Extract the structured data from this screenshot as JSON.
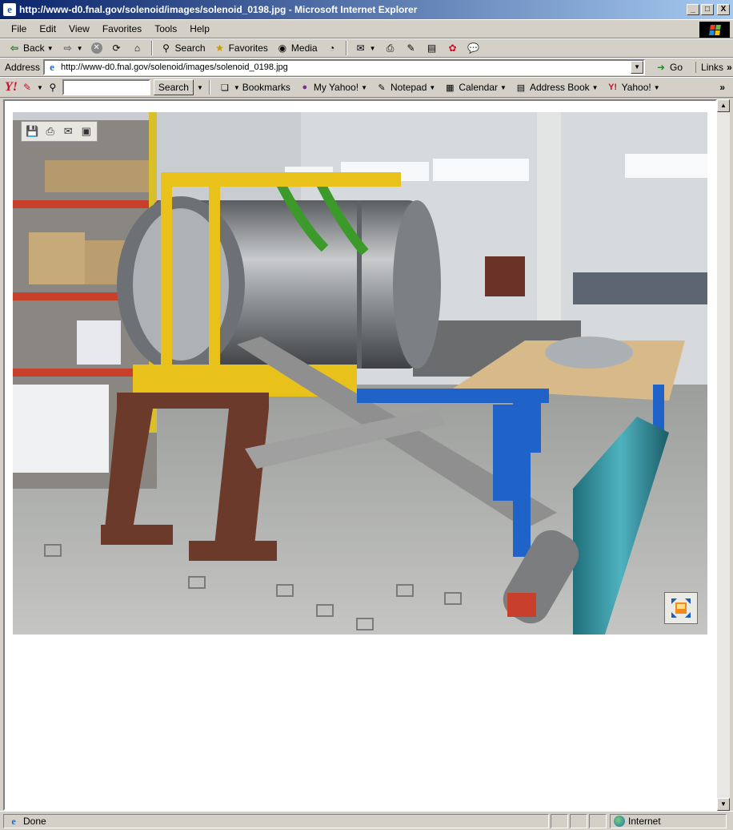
{
  "window": {
    "title": "http://www-d0.fnal.gov/solenoid/images/solenoid_0198.jpg - Microsoft Internet Explorer",
    "controls": {
      "minimize": "_",
      "maximize": "□",
      "close": "X"
    }
  },
  "menu": [
    {
      "label": "File"
    },
    {
      "label": "Edit"
    },
    {
      "label": "View"
    },
    {
      "label": "Favorites"
    },
    {
      "label": "Tools"
    },
    {
      "label": "Help"
    }
  ],
  "toolbar": {
    "back_label": "Back",
    "search_label": "Search",
    "favorites_label": "Favorites",
    "media_label": "Media"
  },
  "address": {
    "label": "Address",
    "url": "http://www-d0.fnal.gov/solenoid/images/solenoid_0198.jpg",
    "go_label": "Go",
    "links_label": "Links"
  },
  "yahoo_toolbar": {
    "logo": "Y!",
    "search_button": "Search",
    "search_value": "",
    "items": [
      {
        "label": "Bookmarks",
        "icon": "bookmarks-icon"
      },
      {
        "label": "My Yahoo!",
        "icon": "my-yahoo-icon"
      },
      {
        "label": "Notepad",
        "icon": "notepad-icon"
      },
      {
        "label": "Calendar",
        "icon": "calendar-icon"
      },
      {
        "label": "Address Book",
        "icon": "address-book-icon"
      },
      {
        "label": "Yahoo!",
        "icon": "yahoo-icon"
      }
    ]
  },
  "content": {
    "image_alt": "Solenoid assembly in workshop (solenoid_0198.jpg)"
  },
  "status": {
    "text": "Done",
    "zone": "Internet"
  }
}
